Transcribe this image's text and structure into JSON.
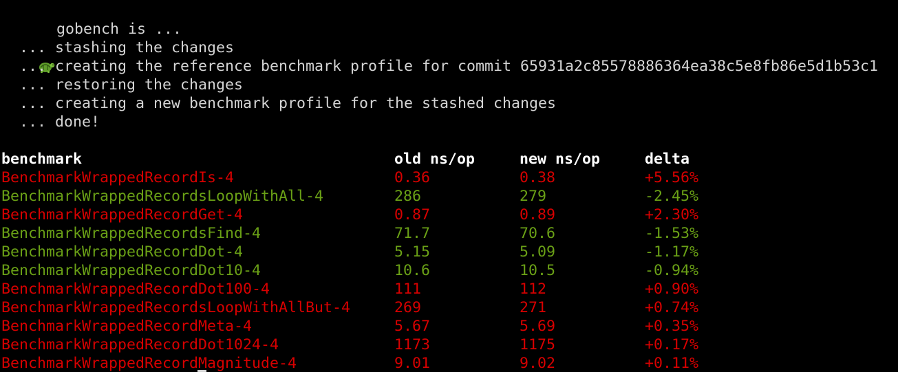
{
  "terminal": {
    "title_text": "gobench is ...",
    "title_icon": "turtle-icon",
    "steps": [
      "... stashing the changes",
      "... creating the reference benchmark profile for commit 65931a2c85578886364ea38c5e8fb86e5d1b53c1",
      "... restoring the changes",
      "... creating a new benchmark profile for the stashed changes",
      "... done!"
    ]
  },
  "table": {
    "headers": [
      "benchmark",
      "old ns/op",
      "new ns/op",
      "delta"
    ],
    "rows": [
      {
        "name": "BenchmarkWrappedRecordIs-4",
        "old": "0.36",
        "new": "0.38",
        "delta": "+5.56%",
        "status": "regression"
      },
      {
        "name": "BenchmarkWrappedRecordsLoopWithAll-4",
        "old": "286",
        "new": "279",
        "delta": "-2.45%",
        "status": "improvement"
      },
      {
        "name": "BenchmarkWrappedRecordGet-4",
        "old": "0.87",
        "new": "0.89",
        "delta": "+2.30%",
        "status": "regression"
      },
      {
        "name": "BenchmarkWrappedRecordsFind-4",
        "old": "71.7",
        "new": "70.6",
        "delta": "-1.53%",
        "status": "improvement"
      },
      {
        "name": "BenchmarkWrappedRecordDot-4",
        "old": "5.15",
        "new": "5.09",
        "delta": "-1.17%",
        "status": "improvement"
      },
      {
        "name": "BenchmarkWrappedRecordDot10-4",
        "old": "10.6",
        "new": "10.5",
        "delta": "-0.94%",
        "status": "improvement"
      },
      {
        "name": "BenchmarkWrappedRecordDot100-4",
        "old": "111",
        "new": "112",
        "delta": "+0.90%",
        "status": "regression"
      },
      {
        "name": "BenchmarkWrappedRecordsLoopWithAllBut-4",
        "old": "269",
        "new": "271",
        "delta": "+0.74%",
        "status": "regression"
      },
      {
        "name": "BenchmarkWrappedRecordMeta-4",
        "old": "5.67",
        "new": "5.69",
        "delta": "+0.35%",
        "status": "regression"
      },
      {
        "name": "BenchmarkWrappedRecordDot1024-4",
        "old": "1173",
        "new": "1175",
        "delta": "+0.17%",
        "status": "regression"
      },
      {
        "name": "BenchmarkWrappedRecordMagnitude-4",
        "old": "9.01",
        "new": "9.02",
        "delta": "+0.11%",
        "status": "regression"
      }
    ]
  },
  "colors": {
    "background": "#000000",
    "text": "#d4d4d4",
    "header": "#ffffff",
    "regression": "#d70000",
    "improvement": "#6aa016"
  }
}
